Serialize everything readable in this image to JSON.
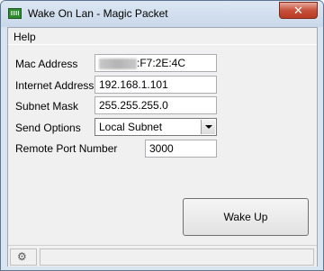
{
  "window": {
    "title": "Wake On Lan - Magic Packet",
    "close_label": "✕"
  },
  "menu": {
    "help": "Help"
  },
  "form": {
    "mac_label": "Mac Address",
    "mac_value_visible": ":F7:2E:4C",
    "internet_label": "Internet Address",
    "internet_value": "192.168.1.101",
    "subnet_label": "Subnet Mask",
    "subnet_value": "255.255.255.0",
    "send_label": "Send Options",
    "send_value": "Local Subnet",
    "port_label": "Remote Port Number",
    "port_value": "3000"
  },
  "actions": {
    "wake_up": "Wake Up"
  },
  "status": {
    "text": ""
  }
}
